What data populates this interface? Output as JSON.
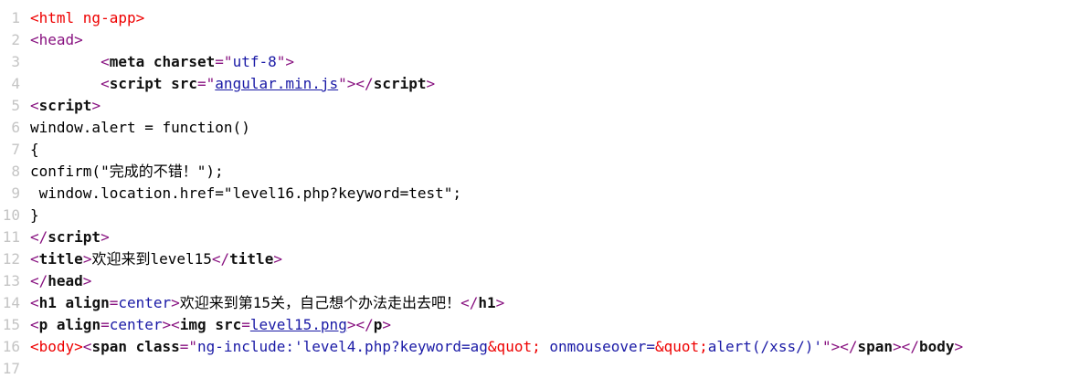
{
  "viewer": {
    "type": "view-source",
    "lines": [
      {
        "n": "1",
        "segments": [
          {
            "t": "<html ng-app>",
            "c": "tag-err"
          }
        ]
      },
      {
        "n": "2",
        "segments": [
          {
            "t": "<head>",
            "c": "tag"
          }
        ]
      },
      {
        "n": "3",
        "segments": [
          {
            "t": "        ",
            "c": "text"
          },
          {
            "t": "<",
            "c": "tag"
          },
          {
            "t": "meta charset",
            "c": "attr"
          },
          {
            "t": "=\"",
            "c": "tag"
          },
          {
            "t": "utf-8",
            "c": "val"
          },
          {
            "t": "\">",
            "c": "tag"
          }
        ]
      },
      {
        "n": "4",
        "segments": [
          {
            "t": "        ",
            "c": "text"
          },
          {
            "t": "<",
            "c": "tag"
          },
          {
            "t": "script src",
            "c": "attr"
          },
          {
            "t": "=\"",
            "c": "tag"
          },
          {
            "t": "angular.min.js",
            "c": "link"
          },
          {
            "t": "\"></",
            "c": "tag"
          },
          {
            "t": "script",
            "c": "attr"
          },
          {
            "t": ">",
            "c": "tag"
          }
        ]
      },
      {
        "n": "5",
        "segments": [
          {
            "t": "<",
            "c": "tag"
          },
          {
            "t": "script",
            "c": "attr"
          },
          {
            "t": ">",
            "c": "tag"
          }
        ]
      },
      {
        "n": "6",
        "segments": [
          {
            "t": "window.alert = function()",
            "c": "text"
          }
        ]
      },
      {
        "n": "7",
        "segments": [
          {
            "t": "{",
            "c": "text"
          }
        ]
      },
      {
        "n": "8",
        "segments": [
          {
            "t": "confirm(\"完成的不错！\");",
            "c": "text"
          }
        ]
      },
      {
        "n": "9",
        "segments": [
          {
            "t": " window.location.href=\"level16.php?keyword=test\";",
            "c": "text"
          }
        ]
      },
      {
        "n": "10",
        "segments": [
          {
            "t": "}",
            "c": "text"
          }
        ]
      },
      {
        "n": "11",
        "segments": [
          {
            "t": "</",
            "c": "tag"
          },
          {
            "t": "script",
            "c": "attr"
          },
          {
            "t": ">",
            "c": "tag"
          }
        ]
      },
      {
        "n": "12",
        "segments": [
          {
            "t": "<",
            "c": "tag"
          },
          {
            "t": "title",
            "c": "attr"
          },
          {
            "t": ">",
            "c": "tag"
          },
          {
            "t": "欢迎来到level15",
            "c": "text"
          },
          {
            "t": "</",
            "c": "tag"
          },
          {
            "t": "title",
            "c": "attr"
          },
          {
            "t": ">",
            "c": "tag"
          }
        ]
      },
      {
        "n": "13",
        "segments": [
          {
            "t": "</",
            "c": "tag"
          },
          {
            "t": "head",
            "c": "attr"
          },
          {
            "t": ">",
            "c": "tag"
          }
        ]
      },
      {
        "n": "14",
        "segments": [
          {
            "t": "<",
            "c": "tag"
          },
          {
            "t": "h1 align",
            "c": "attr"
          },
          {
            "t": "=",
            "c": "tag"
          },
          {
            "t": "center",
            "c": "val"
          },
          {
            "t": ">",
            "c": "tag"
          },
          {
            "t": "欢迎来到第15关，自己想个办法走出去吧！",
            "c": "text"
          },
          {
            "t": "</",
            "c": "tag"
          },
          {
            "t": "h1",
            "c": "attr"
          },
          {
            "t": ">",
            "c": "tag"
          }
        ]
      },
      {
        "n": "15",
        "segments": [
          {
            "t": "<",
            "c": "tag"
          },
          {
            "t": "p align",
            "c": "attr"
          },
          {
            "t": "=",
            "c": "tag"
          },
          {
            "t": "center",
            "c": "val"
          },
          {
            "t": "><",
            "c": "tag"
          },
          {
            "t": "img src",
            "c": "attr"
          },
          {
            "t": "=",
            "c": "tag"
          },
          {
            "t": "level15.png",
            "c": "link"
          },
          {
            "t": "></",
            "c": "tag"
          },
          {
            "t": "p",
            "c": "attr"
          },
          {
            "t": ">",
            "c": "tag"
          }
        ]
      },
      {
        "n": "16",
        "segments": [
          {
            "t": "<body>",
            "c": "tag-err"
          },
          {
            "t": "<",
            "c": "tag"
          },
          {
            "t": "span class",
            "c": "attr"
          },
          {
            "t": "=\"",
            "c": "tag"
          },
          {
            "t": "ng-include:'level4.php?keyword=ag",
            "c": "val"
          },
          {
            "t": "&quot;",
            "c": "ent"
          },
          {
            "t": " onmouseover=",
            "c": "val"
          },
          {
            "t": "&quot;",
            "c": "ent"
          },
          {
            "t": "alert(/xss/)'",
            "c": "val"
          },
          {
            "t": "\"></",
            "c": "tag"
          },
          {
            "t": "span",
            "c": "attr"
          },
          {
            "t": "></",
            "c": "tag"
          },
          {
            "t": "body",
            "c": "attr"
          },
          {
            "t": ">",
            "c": "tag"
          }
        ]
      },
      {
        "n": "17",
        "segments": []
      }
    ]
  }
}
